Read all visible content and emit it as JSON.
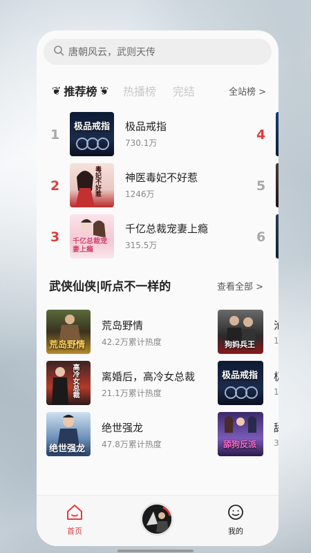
{
  "search": {
    "placeholder": "唐朝风云，武则天传"
  },
  "rank_tabs": {
    "active": "推荐榜",
    "tabs": [
      "热播榜",
      "完结"
    ],
    "all_link": "全站榜 >"
  },
  "rank_list": [
    {
      "rank": "1",
      "title": "极品戒指",
      "count": "730.1万",
      "right_rank": "4",
      "cover_text": "极品戒指"
    },
    {
      "rank": "2",
      "title": "神医毒妃不好惹",
      "count": "1246万",
      "right_rank": "5",
      "cover_text": "毒妃不好惹"
    },
    {
      "rank": "3",
      "title": "千亿总裁宠妻上瘾",
      "count": "315.5万",
      "right_rank": "6",
      "cover_text": "千亿总裁宠妻上瘾"
    }
  ],
  "section": {
    "title": "武侠仙侠|听点不一样的",
    "view_all": "查看全部 >"
  },
  "books": [
    {
      "title": "荒岛野情",
      "heat": "42.2万累计热度",
      "cover_text": "荒岛野情",
      "right_title": "沧",
      "right_heat": "1",
      "right_cover_text": "狗妈兵王"
    },
    {
      "title": "离婚后，高冷女总裁",
      "heat": "21.1万累计热度",
      "cover_text": "高冷女总裁",
      "right_title": "极",
      "right_heat": "1",
      "right_cover_text": "极品戒指"
    },
    {
      "title": "绝世强龙",
      "heat": "47.8万累计热度",
      "cover_text": "绝世强龙",
      "right_title": "舔",
      "right_heat": "3",
      "right_cover_text": "舔狗反派"
    }
  ],
  "bottom_nav": {
    "home": "首页",
    "mine": "我的"
  },
  "colors": {
    "accent": "#e33a3a",
    "rank_gray": "#a8a8a8"
  }
}
